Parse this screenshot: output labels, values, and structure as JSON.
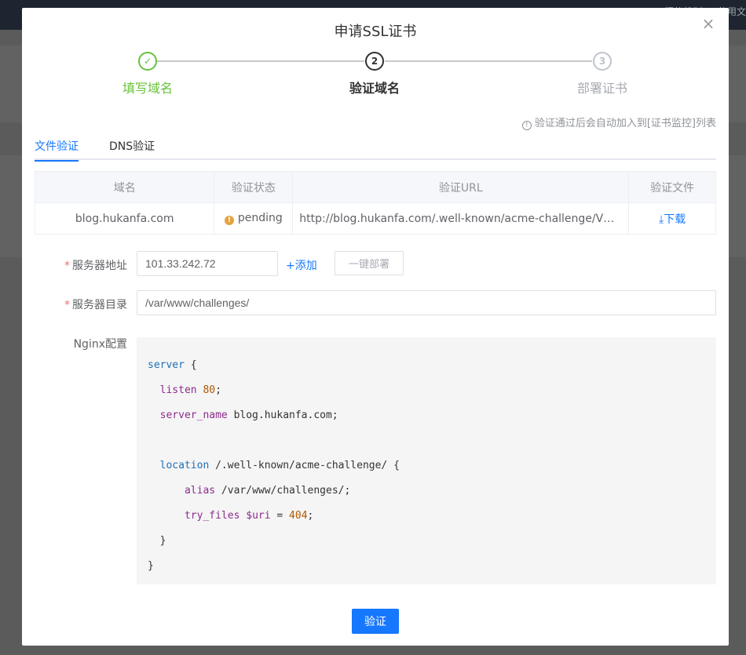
{
  "background": {
    "topbar_text": "湿信机制 … 使用文"
  },
  "dialog": {
    "title": "申请SSL证书",
    "close_icon": "close-icon"
  },
  "steps": [
    {
      "index": "✓",
      "label": "填写域名",
      "state": "finished"
    },
    {
      "index": "2",
      "label": "验证域名",
      "state": "active"
    },
    {
      "index": "3",
      "label": "部署证书",
      "state": "wait"
    }
  ],
  "tip": {
    "icon": "info-icon",
    "text": "验证通过后会自动加入到[证书监控]列表"
  },
  "tabs": [
    {
      "label": "文件验证",
      "active": true
    },
    {
      "label": "DNS验证",
      "active": false
    }
  ],
  "table": {
    "headers": [
      "域名",
      "验证状态",
      "验证URL",
      "验证文件"
    ],
    "row": {
      "domain": "blog.hukanfa.com",
      "status_icon": "!",
      "status": "pending",
      "url": "http://blog.hukanfa.com/.well-known/acme-challenge/VQgQZM...",
      "download_icon": "⤓",
      "download_label": "下载"
    }
  },
  "form": {
    "server_address_label": "服务器地址",
    "server_address_value": "101.33.242.72",
    "add_label": "+添加",
    "deploy_label": "一键部署",
    "server_dir_label": "服务器目录",
    "server_dir_value": "/var/www/challenges/",
    "nginx_label": "Nginx配置"
  },
  "nginx_config": {
    "l1_kw": "server",
    "l1_rest": " {",
    "l2_prop": "listen",
    "l2_num": "80",
    "l2_rest": ";",
    "l3_prop": "server_name",
    "l3_rest": " blog.hukanfa.com;",
    "l5_kw": "location",
    "l5_rest": " /.well-known/acme-challenge/ {",
    "l6_prop": "alias",
    "l6_rest": " /var/www/challenges/;",
    "l7_prop": "try_files",
    "l7_var": "$uri",
    "l7_eq": " = ",
    "l7_num": "404",
    "l7_rest": ";",
    "l8": "}",
    "l9": "}"
  },
  "footer": {
    "verify_label": "验证"
  }
}
